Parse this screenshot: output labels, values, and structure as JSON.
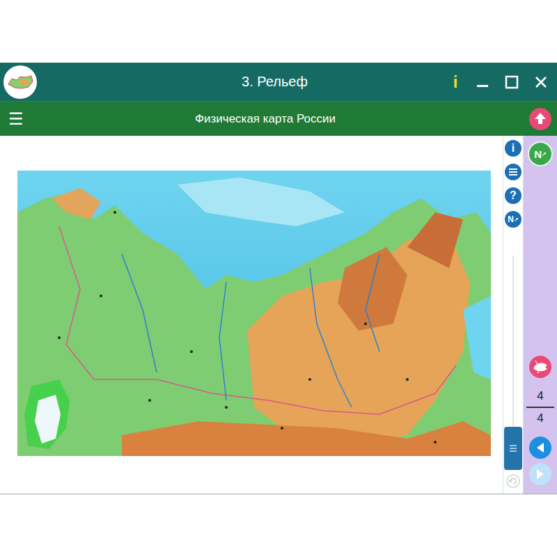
{
  "window": {
    "title": "3. Рельеф",
    "info": "i"
  },
  "toolbar": {
    "menu": "☰",
    "title": "Физическая карта России"
  },
  "tools": [
    {
      "kind": "text",
      "label": "i"
    },
    {
      "kind": "layers"
    },
    {
      "kind": "text",
      "label": "?"
    },
    {
      "kind": "numbered",
      "label": "N"
    }
  ],
  "zoom": {
    "level": 0
  },
  "refresh": {
    "disabled": true
  },
  "side": {
    "numbered": "N",
    "pager": {
      "current": "4",
      "total": "4"
    },
    "prev": {
      "disabled": false
    },
    "next": {
      "disabled": true
    }
  }
}
